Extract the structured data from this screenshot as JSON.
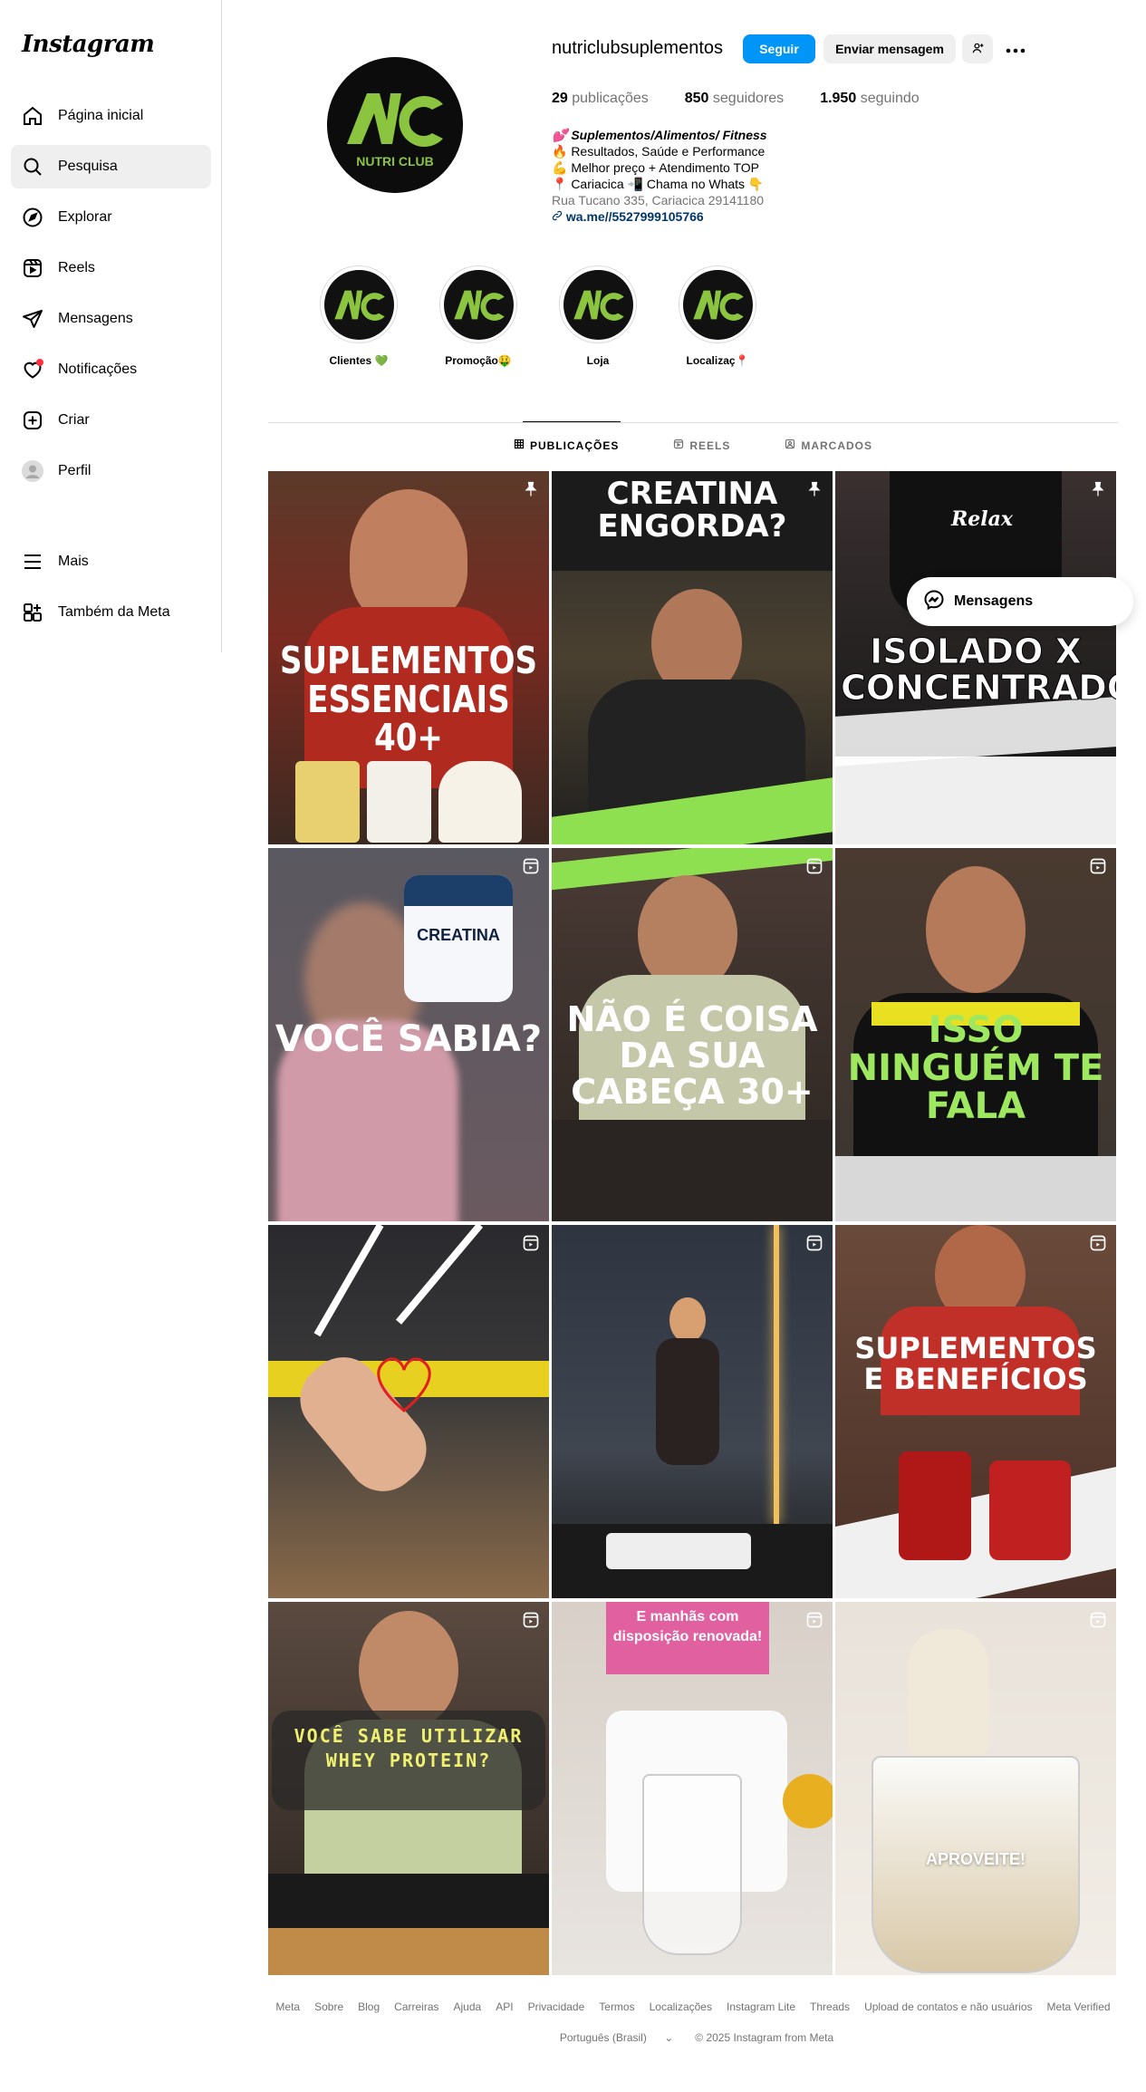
{
  "app": {
    "logo_text": "Instagram"
  },
  "sidebar": {
    "items": [
      {
        "label": "Página inicial",
        "icon": "home-icon"
      },
      {
        "label": "Pesquisa",
        "icon": "search-icon",
        "active": true
      },
      {
        "label": "Explorar",
        "icon": "compass-icon"
      },
      {
        "label": "Reels",
        "icon": "reels-icon"
      },
      {
        "label": "Mensagens",
        "icon": "send-icon"
      },
      {
        "label": "Notificações",
        "icon": "heart-icon",
        "badge": true
      },
      {
        "label": "Criar",
        "icon": "plus-square-icon"
      },
      {
        "label": "Perfil",
        "icon": "avatar"
      }
    ],
    "bottom": [
      {
        "label": "Mais",
        "icon": "menu-icon"
      },
      {
        "label": "Também da Meta",
        "icon": "meta-apps-icon"
      }
    ]
  },
  "profile": {
    "username": "nutriclubsuplementos",
    "follow_label": "Seguir",
    "message_label": "Enviar mensagem",
    "stats": {
      "posts_count": "29",
      "posts_label": "publicações",
      "followers_count": "850",
      "followers_label": "seguidores",
      "following_count": "1.950",
      "following_label": "seguindo"
    },
    "bio": {
      "name": "💕 Suplementos/Alimentos/ Fitness",
      "line1": "🔥 Resultados, Saúde e Performance",
      "line2": "💪 Melhor preço + Atendimento TOP",
      "line3": "📍 Cariacica 📲 Chama no Whats 👇",
      "address": "Rua Tucano 335, Cariacica 29141180",
      "link": "wa.me//5527999105766"
    },
    "pic_text": {
      "letters": "NC",
      "brand": "NUTRI CLUB"
    }
  },
  "highlights": [
    {
      "label": "Clientes 💚"
    },
    {
      "label": "Promoção🤑"
    },
    {
      "label": "Loja"
    },
    {
      "label": "Localizaç📍"
    }
  ],
  "tabs": [
    {
      "label": "PUBLICAÇÕES",
      "active": true
    },
    {
      "label": "REELS"
    },
    {
      "label": "MARCADOS"
    }
  ],
  "posts": [
    {
      "text": "SUPLEMENTOS ESSENCIAIS 40+",
      "corner": "pin"
    },
    {
      "text": "CREATINA ENGORDA?",
      "corner": "pin"
    },
    {
      "text": "ISOLADO X CONCENTRADO",
      "corner": "pin"
    },
    {
      "text": "VOCÊ SABIA?",
      "corner": "reel"
    },
    {
      "text": "NÃO É COISA DA SUA CABEÇA 30+",
      "corner": "reel"
    },
    {
      "text": "ISSO NINGUÉM TE FALA",
      "corner": "reel"
    },
    {
      "text": "",
      "corner": "reel"
    },
    {
      "text": "",
      "corner": "reel"
    },
    {
      "text": "SUPLEMENTOS E BENEFÍCIOS",
      "corner": "reel"
    },
    {
      "text": "VOCÊ SABE UTILIZAR WHEY PROTEIN?",
      "corner": "reel"
    },
    {
      "text": "E manhãs com disposição renovada!",
      "corner": "reel"
    },
    {
      "text": "APROVEITE!",
      "corner": "reel"
    }
  ],
  "post_texts_extra": {
    "relax": "Relax",
    "creatina_label": "CREATINA"
  },
  "floating": {
    "messages_label": "Mensagens"
  },
  "footer": {
    "links": [
      "Meta",
      "Sobre",
      "Blog",
      "Carreiras",
      "Ajuda",
      "API",
      "Privacidade",
      "Termos",
      "Localizações",
      "Instagram Lite",
      "Threads",
      "Upload de contatos e não usuários",
      "Meta Verified"
    ],
    "language": "Português (Brasil)",
    "copyright": "© 2025 Instagram from Meta"
  },
  "colors": {
    "accent": "#0095f6",
    "brand_green": "#8bc53f",
    "notif": "#ff3040"
  }
}
